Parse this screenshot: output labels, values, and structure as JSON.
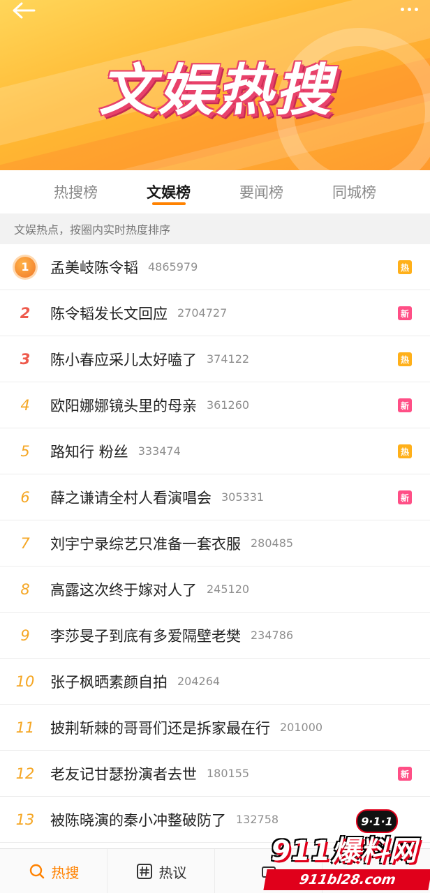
{
  "header": {
    "banner_title": "文娱热搜"
  },
  "tabs": [
    {
      "label": "热搜榜",
      "active": false
    },
    {
      "label": "文娱榜",
      "active": true
    },
    {
      "label": "要闻榜",
      "active": false
    },
    {
      "label": "同城榜",
      "active": false
    }
  ],
  "subtitle": "文娱热点，按圈内实时热度排序",
  "items": [
    {
      "rank": "1",
      "title": "孟美岐陈令韬",
      "count": "4865979",
      "tag": "热"
    },
    {
      "rank": "2",
      "title": "陈令韬发长文回应",
      "count": "2704727",
      "tag": "新"
    },
    {
      "rank": "3",
      "title": "陈小春应采儿太好嗑了",
      "count": "374122",
      "tag": "热"
    },
    {
      "rank": "4",
      "title": "欧阳娜娜镜头里的母亲",
      "count": "361260",
      "tag": "新"
    },
    {
      "rank": "5",
      "title": "路知行 粉丝",
      "count": "333474",
      "tag": "热"
    },
    {
      "rank": "6",
      "title": "薛之谦请全村人看演唱会",
      "count": "305331",
      "tag": "新"
    },
    {
      "rank": "7",
      "title": "刘宇宁录综艺只准备一套衣服",
      "count": "280485",
      "tag": ""
    },
    {
      "rank": "8",
      "title": "高露这次终于嫁对人了",
      "count": "245120",
      "tag": ""
    },
    {
      "rank": "9",
      "title": "李莎旻子到底有多爱隔壁老樊",
      "count": "234786",
      "tag": ""
    },
    {
      "rank": "10",
      "title": "张子枫晒素颜自拍",
      "count": "204264",
      "tag": ""
    },
    {
      "rank": "11",
      "title": "披荆斩棘的哥哥们还是拆家最在行",
      "count": "201000",
      "tag": ""
    },
    {
      "rank": "12",
      "title": "老友记甘瑟扮演者去世",
      "count": "180155",
      "tag": "新"
    },
    {
      "rank": "13",
      "title": "被陈晓演的秦小冲整破防了",
      "count": "132758",
      "tag": ""
    }
  ],
  "bottom_nav": [
    {
      "label": "热搜",
      "icon": "search-icon",
      "active": true
    },
    {
      "label": "热议",
      "icon": "hashtag-icon",
      "active": false
    }
  ],
  "watermark": {
    "badge": "9·1·1",
    "brand": "911爆料网",
    "url": "911bl28.com"
  },
  "colors": {
    "accent": "#ff8200",
    "hot_tag": "#ffb01a",
    "new_tag": "#ff4f86",
    "rank_top": "#ee5a4c",
    "rank_other": "#f5a623"
  }
}
